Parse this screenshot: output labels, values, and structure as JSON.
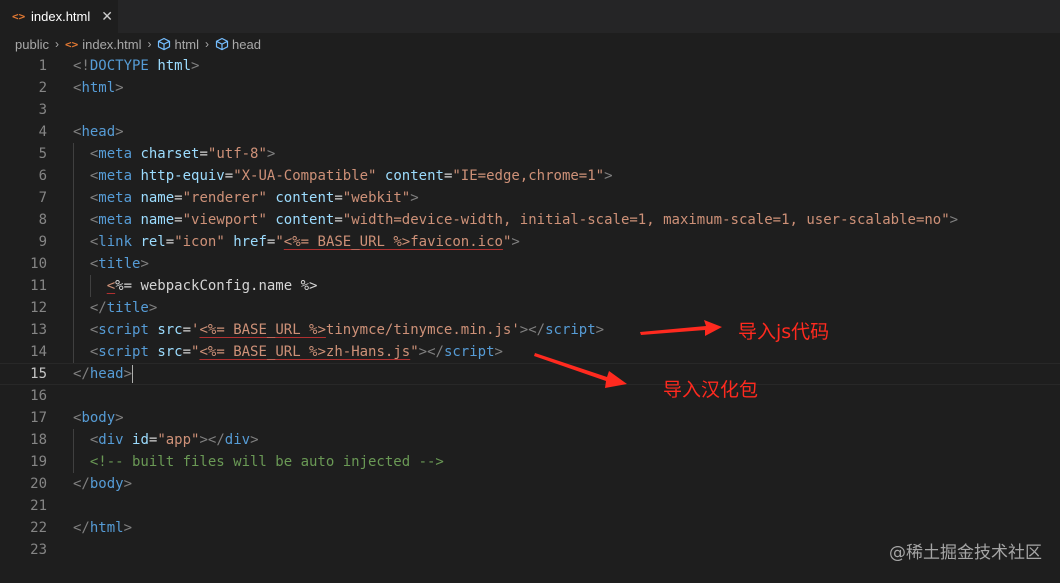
{
  "tab": {
    "icon": "html-code-icon",
    "label": "index.html",
    "close_glyph": "✕"
  },
  "breadcrumb": {
    "items": [
      "public",
      "index.html",
      "html",
      "head"
    ],
    "separator": "›"
  },
  "editor": {
    "current_line": 15,
    "lines": [
      {
        "n": "1",
        "toks": [
          [
            "t",
            "<!"
          ],
          [
            "tn",
            "DOCTYPE"
          ],
          [
            "tx",
            " "
          ],
          [
            "an",
            "html"
          ],
          [
            "t",
            ">"
          ]
        ]
      },
      {
        "n": "2",
        "toks": [
          [
            "t",
            "<"
          ],
          [
            "tn",
            "html"
          ],
          [
            "t",
            ">"
          ]
        ]
      },
      {
        "n": "3",
        "toks": []
      },
      {
        "n": "4",
        "toks": [
          [
            "t",
            "<"
          ],
          [
            "tn",
            "head"
          ],
          [
            "t",
            ">"
          ]
        ]
      },
      {
        "n": "5",
        "toks": [
          [
            "tx",
            "  "
          ],
          [
            "t",
            "<"
          ],
          [
            "tn",
            "meta"
          ],
          [
            "tx",
            " "
          ],
          [
            "an",
            "charset"
          ],
          [
            "tx",
            "="
          ],
          [
            "av",
            "\"utf-8\""
          ],
          [
            "t",
            ">"
          ]
        ]
      },
      {
        "n": "6",
        "toks": [
          [
            "tx",
            "  "
          ],
          [
            "t",
            "<"
          ],
          [
            "tn",
            "meta"
          ],
          [
            "tx",
            " "
          ],
          [
            "an",
            "http-equiv"
          ],
          [
            "tx",
            "="
          ],
          [
            "av",
            "\"X-UA-Compatible\""
          ],
          [
            "tx",
            " "
          ],
          [
            "an",
            "content"
          ],
          [
            "tx",
            "="
          ],
          [
            "av",
            "\"IE=edge,chrome=1\""
          ],
          [
            "t",
            ">"
          ]
        ]
      },
      {
        "n": "7",
        "toks": [
          [
            "tx",
            "  "
          ],
          [
            "t",
            "<"
          ],
          [
            "tn",
            "meta"
          ],
          [
            "tx",
            " "
          ],
          [
            "an",
            "name"
          ],
          [
            "tx",
            "="
          ],
          [
            "av",
            "\"renderer\""
          ],
          [
            "tx",
            " "
          ],
          [
            "an",
            "content"
          ],
          [
            "tx",
            "="
          ],
          [
            "av",
            "\"webkit\""
          ],
          [
            "t",
            ">"
          ]
        ]
      },
      {
        "n": "8",
        "toks": [
          [
            "tx",
            "  "
          ],
          [
            "t",
            "<"
          ],
          [
            "tn",
            "meta"
          ],
          [
            "tx",
            " "
          ],
          [
            "an",
            "name"
          ],
          [
            "tx",
            "="
          ],
          [
            "av",
            "\"viewport\""
          ],
          [
            "tx",
            " "
          ],
          [
            "an",
            "content"
          ],
          [
            "tx",
            "="
          ],
          [
            "av",
            "\"width=device-width, initial-scale=1, maximum-scale=1, user-scalable=no\""
          ],
          [
            "t",
            ">"
          ]
        ]
      },
      {
        "n": "9",
        "toks": [
          [
            "tx",
            "  "
          ],
          [
            "t",
            "<"
          ],
          [
            "tn",
            "link"
          ],
          [
            "tx",
            " "
          ],
          [
            "an",
            "rel"
          ],
          [
            "tx",
            "="
          ],
          [
            "av",
            "\"icon\""
          ],
          [
            "tx",
            " "
          ],
          [
            "an",
            "href"
          ],
          [
            "tx",
            "="
          ],
          [
            "av",
            "\""
          ],
          [
            "av ul",
            "<%= BASE_URL %>favicon.ico"
          ],
          [
            "av",
            "\""
          ],
          [
            "t",
            ">"
          ]
        ]
      },
      {
        "n": "10",
        "toks": [
          [
            "tx",
            "  "
          ],
          [
            "t",
            "<"
          ],
          [
            "tn",
            "title"
          ],
          [
            "t",
            ">"
          ]
        ]
      },
      {
        "n": "11",
        "toks": [
          [
            "tx",
            "    "
          ],
          [
            "av ul",
            "<"
          ],
          [
            "tx",
            "%= webpackConfig.name %>"
          ]
        ]
      },
      {
        "n": "12",
        "toks": [
          [
            "tx",
            "  "
          ],
          [
            "t",
            "</"
          ],
          [
            "tn",
            "title"
          ],
          [
            "t",
            ">"
          ]
        ]
      },
      {
        "n": "13",
        "toks": [
          [
            "tx",
            "  "
          ],
          [
            "t",
            "<"
          ],
          [
            "tn",
            "script"
          ],
          [
            "tx",
            " "
          ],
          [
            "an",
            "src"
          ],
          [
            "tx",
            "="
          ],
          [
            "av",
            "'"
          ],
          [
            "av ul",
            "<%= BASE_URL %>"
          ],
          [
            "av",
            "tinymce/tinymce.min.js'"
          ],
          [
            "t",
            "></"
          ],
          [
            "tn",
            "script"
          ],
          [
            "t",
            ">"
          ]
        ]
      },
      {
        "n": "14",
        "toks": [
          [
            "tx",
            "  "
          ],
          [
            "t",
            "<"
          ],
          [
            "tn",
            "script"
          ],
          [
            "tx",
            " "
          ],
          [
            "an",
            "src"
          ],
          [
            "tx",
            "="
          ],
          [
            "av",
            "\""
          ],
          [
            "av ul",
            "<%= BASE_URL %>zh-Hans.js"
          ],
          [
            "av",
            "\""
          ],
          [
            "t",
            "></"
          ],
          [
            "tn",
            "script"
          ],
          [
            "t",
            ">"
          ]
        ]
      },
      {
        "n": "15",
        "toks": [
          [
            "t",
            "</"
          ],
          [
            "tn",
            "head"
          ],
          [
            "t",
            ">"
          ]
        ]
      },
      {
        "n": "16",
        "toks": []
      },
      {
        "n": "17",
        "toks": [
          [
            "t",
            "<"
          ],
          [
            "tn",
            "body"
          ],
          [
            "t",
            ">"
          ]
        ]
      },
      {
        "n": "18",
        "toks": [
          [
            "tx",
            "  "
          ],
          [
            "t",
            "<"
          ],
          [
            "tn",
            "div"
          ],
          [
            "tx",
            " "
          ],
          [
            "an",
            "id"
          ],
          [
            "tx",
            "="
          ],
          [
            "av",
            "\"app\""
          ],
          [
            "t",
            "></"
          ],
          [
            "tn",
            "div"
          ],
          [
            "t",
            ">"
          ]
        ]
      },
      {
        "n": "19",
        "toks": [
          [
            "tx",
            "  "
          ],
          [
            "cm",
            "<!-- built files will be auto injected -->"
          ]
        ]
      },
      {
        "n": "20",
        "toks": [
          [
            "t",
            "</"
          ],
          [
            "tn",
            "body"
          ],
          [
            "t",
            ">"
          ]
        ]
      },
      {
        "n": "21",
        "toks": []
      },
      {
        "n": "22",
        "toks": [
          [
            "t",
            "</"
          ],
          [
            "tn",
            "html"
          ],
          [
            "t",
            ">"
          ]
        ]
      },
      {
        "n": "23",
        "toks": []
      }
    ]
  },
  "annotations": {
    "import_js": "导入js代码",
    "import_lang": "导入汉化包",
    "color": "#ff2a1f"
  },
  "watermark": "@稀土掘金技术社区"
}
